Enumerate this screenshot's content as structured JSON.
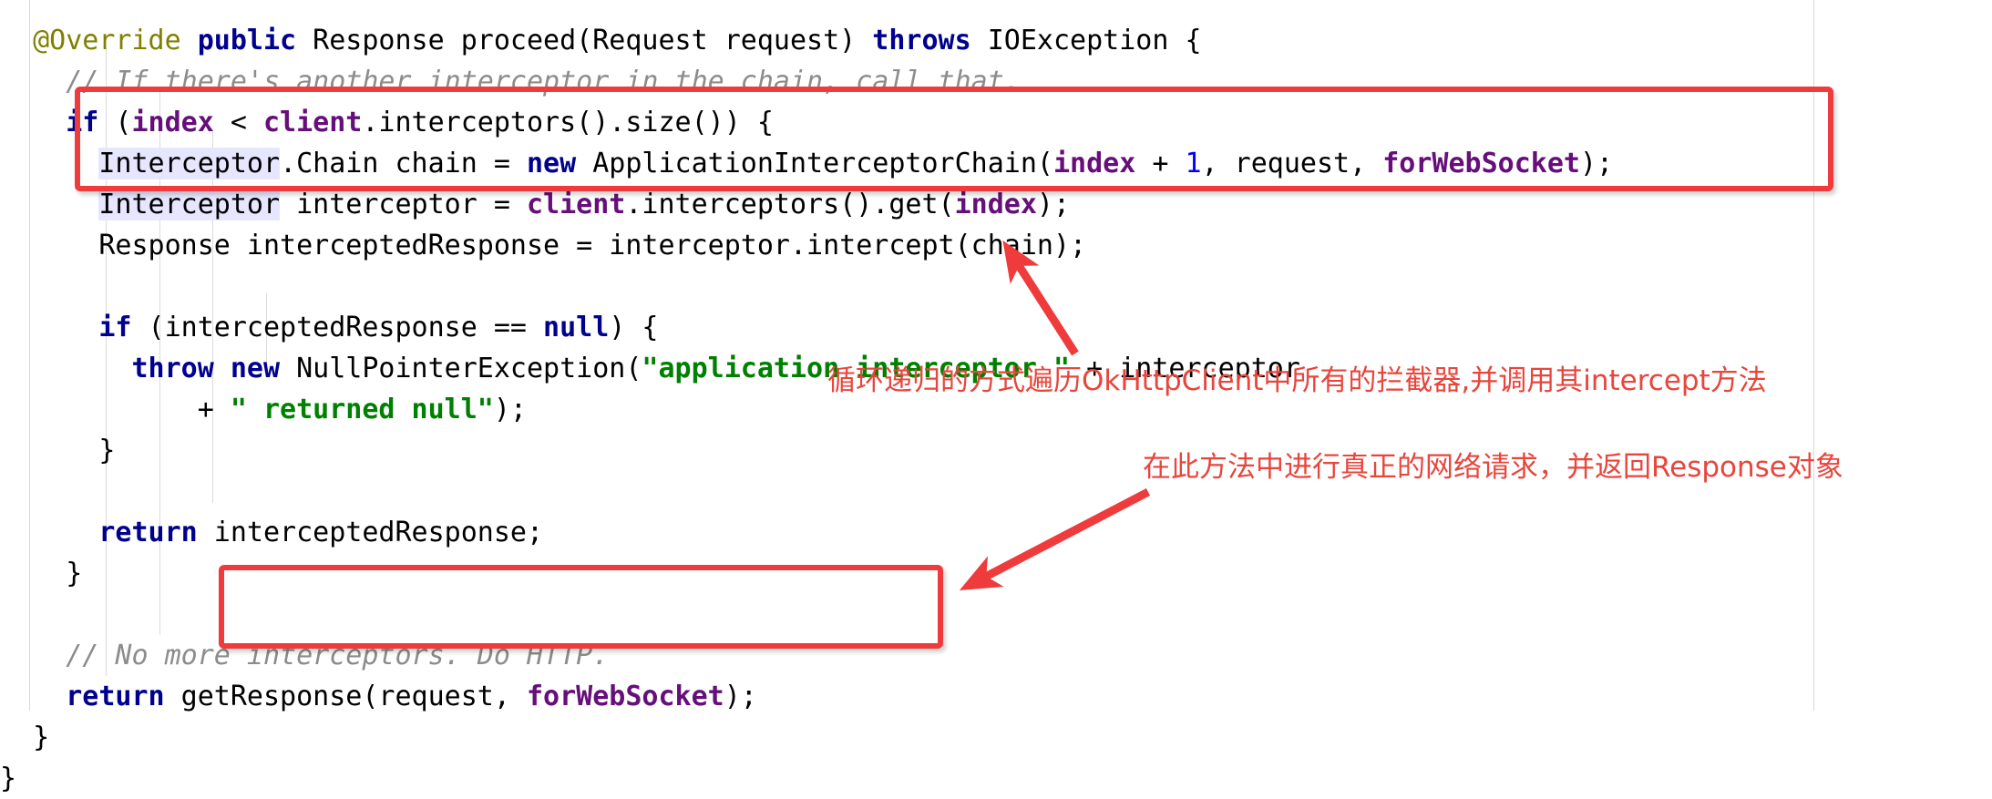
{
  "editor": {
    "language": "java",
    "background_color": "#ffffff",
    "selection_highlight_color": "#e6e6ff",
    "guide_line_color": "#d8d8d8",
    "code_lines": [
      {
        "id": "line-signature",
        "indent": "  ",
        "tokens": [
          {
            "t": "@Override",
            "c": "anno"
          },
          {
            "t": " ",
            "c": "plain"
          },
          {
            "t": "public",
            "c": "kw"
          },
          {
            "t": " Response proceed(Request request) ",
            "c": "plain"
          },
          {
            "t": "throws",
            "c": "kw"
          },
          {
            "t": " IOException {",
            "c": "plain"
          }
        ]
      },
      {
        "id": "line-comment-chain",
        "indent": "    ",
        "tokens": [
          {
            "t": "// If there's another interceptor in the chain, call that.",
            "c": "cmt"
          }
        ]
      },
      {
        "id": "line-if-index",
        "indent": "    ",
        "tokens": [
          {
            "t": "if",
            "c": "kw"
          },
          {
            "t": " (",
            "c": "plain"
          },
          {
            "t": "index",
            "c": "field"
          },
          {
            "t": " < ",
            "c": "plain"
          },
          {
            "t": "client",
            "c": "field"
          },
          {
            "t": ".interceptors().size()) {",
            "c": "plain"
          }
        ]
      },
      {
        "id": "line-chain-decl",
        "indent": "      ",
        "tokens": [
          {
            "t": "Interceptor",
            "c": "plain hl"
          },
          {
            "t": ".Chain chain = ",
            "c": "plain"
          },
          {
            "t": "new",
            "c": "kw"
          },
          {
            "t": " ApplicationInterceptorChain(",
            "c": "plain"
          },
          {
            "t": "index",
            "c": "field"
          },
          {
            "t": " + ",
            "c": "plain"
          },
          {
            "t": "1",
            "c": "num"
          },
          {
            "t": ", request, ",
            "c": "plain"
          },
          {
            "t": "forWebSocket",
            "c": "field"
          },
          {
            "t": ");",
            "c": "plain"
          }
        ]
      },
      {
        "id": "line-interceptor-decl",
        "indent": "      ",
        "tokens": [
          {
            "t": "Interceptor",
            "c": "plain hl"
          },
          {
            "t": " interceptor = ",
            "c": "plain"
          },
          {
            "t": "client",
            "c": "field"
          },
          {
            "t": ".interceptors().get(",
            "c": "plain"
          },
          {
            "t": "index",
            "c": "field"
          },
          {
            "t": ");",
            "c": "plain"
          }
        ]
      },
      {
        "id": "line-intercepted-response",
        "indent": "      ",
        "tokens": [
          {
            "t": "Response interceptedResponse = interceptor.intercept(chain);",
            "c": "plain"
          }
        ]
      },
      {
        "id": "line-blank-1",
        "indent": "",
        "tokens": []
      },
      {
        "id": "line-if-null",
        "indent": "      ",
        "tokens": [
          {
            "t": "if",
            "c": "kw"
          },
          {
            "t": " (interceptedResponse == ",
            "c": "plain"
          },
          {
            "t": "null",
            "c": "kw"
          },
          {
            "t": ") {",
            "c": "plain"
          }
        ]
      },
      {
        "id": "line-throw-npe",
        "indent": "        ",
        "tokens": [
          {
            "t": "throw",
            "c": "kw"
          },
          {
            "t": " ",
            "c": "plain"
          },
          {
            "t": "new",
            "c": "kw"
          },
          {
            "t": " NullPointerException(",
            "c": "plain"
          },
          {
            "t": "\"application interceptor \"",
            "c": "str"
          },
          {
            "t": " + interceptor",
            "c": "plain"
          }
        ]
      },
      {
        "id": "line-returned-null",
        "indent": "            ",
        "tokens": [
          {
            "t": "+ ",
            "c": "plain"
          },
          {
            "t": "\" returned null\"",
            "c": "str"
          },
          {
            "t": ");",
            "c": "plain"
          }
        ]
      },
      {
        "id": "line-close-if-null",
        "indent": "      ",
        "tokens": [
          {
            "t": "}",
            "c": "plain"
          }
        ]
      },
      {
        "id": "line-blank-2",
        "indent": "",
        "tokens": []
      },
      {
        "id": "line-return-intercepted",
        "indent": "      ",
        "tokens": [
          {
            "t": "return",
            "c": "kw"
          },
          {
            "t": " interceptedResponse;",
            "c": "plain"
          }
        ]
      },
      {
        "id": "line-close-if-index",
        "indent": "    ",
        "tokens": [
          {
            "t": "}",
            "c": "plain"
          }
        ]
      },
      {
        "id": "line-blank-3",
        "indent": "",
        "tokens": []
      },
      {
        "id": "line-comment-no-more",
        "indent": "    ",
        "tokens": [
          {
            "t": "// No more interceptors. Do HTTP.",
            "c": "cmt"
          }
        ]
      },
      {
        "id": "line-return-getresponse",
        "indent": "    ",
        "tokens": [
          {
            "t": "return",
            "c": "kw"
          },
          {
            "t": " getResponse(request, ",
            "c": "plain"
          },
          {
            "t": "forWebSocket",
            "c": "field"
          },
          {
            "t": ");",
            "c": "plain"
          }
        ]
      },
      {
        "id": "line-close-method",
        "indent": "  ",
        "tokens": [
          {
            "t": "}",
            "c": "plain"
          }
        ]
      },
      {
        "id": "line-close-class",
        "indent": "",
        "tokens": [
          {
            "t": "}",
            "c": "plain"
          }
        ]
      }
    ]
  },
  "annotations": {
    "color": "#e8453c",
    "box_color": "#ef3b3b",
    "notes": [
      {
        "id": "note-loop",
        "text": "循环递归的方式遍历OkHttpClient中所有的拦截器,并调用其intercept方法"
      },
      {
        "id": "note-http",
        "text": "在此方法中进行真正的网络请求，并返回Response对象"
      }
    ],
    "boxes": [
      {
        "id": "redbox-interceptor-loop",
        "label": "interceptor-loop-highlight"
      },
      {
        "id": "redbox-getresponse",
        "label": "get-response-highlight"
      }
    ],
    "arrows": [
      {
        "id": "arrow-to-loop",
        "direction": "up-left"
      },
      {
        "id": "arrow-to-http",
        "direction": "down-left"
      }
    ]
  }
}
